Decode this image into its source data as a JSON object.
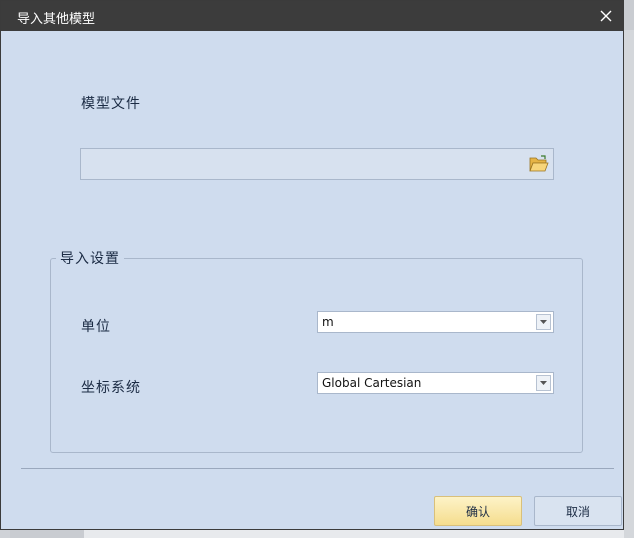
{
  "dialog": {
    "title": "导入其他模型",
    "close_icon": "close-icon"
  },
  "model_file": {
    "label": "模型文件",
    "value": "",
    "browse_icon": "folder-open-icon"
  },
  "import_settings": {
    "group_title": "导入设置",
    "unit": {
      "label": "单位",
      "value": "m"
    },
    "coordinate_system": {
      "label": "坐标系统",
      "value": "Global Cartesian"
    }
  },
  "buttons": {
    "ok": "确认",
    "cancel": "取消"
  },
  "colors": {
    "dialog_bg": "#cfdcee",
    "titlebar_bg": "#3c3c3c",
    "ok_button": "#f5dd8e"
  }
}
